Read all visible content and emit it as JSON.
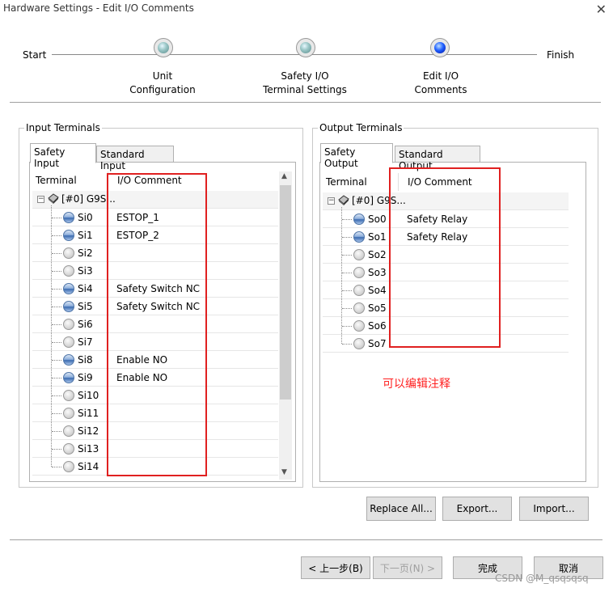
{
  "window": {
    "title": "Hardware Settings - Edit I/O Comments",
    "close_glyph": "✕"
  },
  "wizard": {
    "start": "Start",
    "finish": "Finish",
    "steps": [
      {
        "line1": "Unit",
        "line2": "Configuration"
      },
      {
        "line1": "Safety I/O",
        "line2": "Terminal Settings"
      },
      {
        "line1": "Edit I/O",
        "line2": "Comments"
      }
    ]
  },
  "input": {
    "group_title": "Input Terminals",
    "tabs": [
      "Safety Input",
      "Standard Input"
    ],
    "col_terminal": "Terminal",
    "col_comment": "I/O Comment",
    "root": "[#0] G9S...",
    "rows": [
      {
        "name": "Si0",
        "comment": "ESTOP_1",
        "assigned": true
      },
      {
        "name": "Si1",
        "comment": "ESTOP_2",
        "assigned": true
      },
      {
        "name": "Si2",
        "comment": "",
        "assigned": false
      },
      {
        "name": "Si3",
        "comment": "",
        "assigned": false
      },
      {
        "name": "Si4",
        "comment": "Safety Switch NC",
        "assigned": true
      },
      {
        "name": "Si5",
        "comment": "Safety Switch NC",
        "assigned": true
      },
      {
        "name": "Si6",
        "comment": "",
        "assigned": false
      },
      {
        "name": "Si7",
        "comment": "",
        "assigned": false
      },
      {
        "name": "Si8",
        "comment": "Enable NO",
        "assigned": true
      },
      {
        "name": "Si9",
        "comment": "Enable NO",
        "assigned": true
      },
      {
        "name": "Si10",
        "comment": "",
        "assigned": false
      },
      {
        "name": "Si11",
        "comment": "",
        "assigned": false
      },
      {
        "name": "Si12",
        "comment": "",
        "assigned": false
      },
      {
        "name": "Si13",
        "comment": "",
        "assigned": false
      },
      {
        "name": "Si14",
        "comment": "",
        "assigned": false
      }
    ],
    "scroll_up": "▲",
    "scroll_down": "▼"
  },
  "output": {
    "group_title": "Output Terminals",
    "tabs": [
      "Safety Output",
      "Standard Output"
    ],
    "col_terminal": "Terminal",
    "col_comment": "I/O Comment",
    "root": "[#0] G9S...",
    "rows": [
      {
        "name": "So0",
        "comment": "Safety Relay",
        "assigned": true
      },
      {
        "name": "So1",
        "comment": "Safety Relay",
        "assigned": true
      },
      {
        "name": "So2",
        "comment": "",
        "assigned": false
      },
      {
        "name": "So3",
        "comment": "",
        "assigned": false
      },
      {
        "name": "So4",
        "comment": "",
        "assigned": false
      },
      {
        "name": "So5",
        "comment": "",
        "assigned": false
      },
      {
        "name": "So6",
        "comment": "",
        "assigned": false
      },
      {
        "name": "So7",
        "comment": "",
        "assigned": false
      }
    ]
  },
  "annotation": "可以编辑注释",
  "buttons": {
    "replace_all": "Replace All...",
    "export": "Export...",
    "import": "Import...",
    "back": "< 上一步(B)",
    "next": "下一页(N) >",
    "finish": "完成",
    "cancel": "取消"
  },
  "watermark": "CSDN @M_qsqsqsq",
  "colors": {
    "highlight_box": "#e02020",
    "annotation_text": "#ff2020",
    "current_step": "#2060ff"
  }
}
